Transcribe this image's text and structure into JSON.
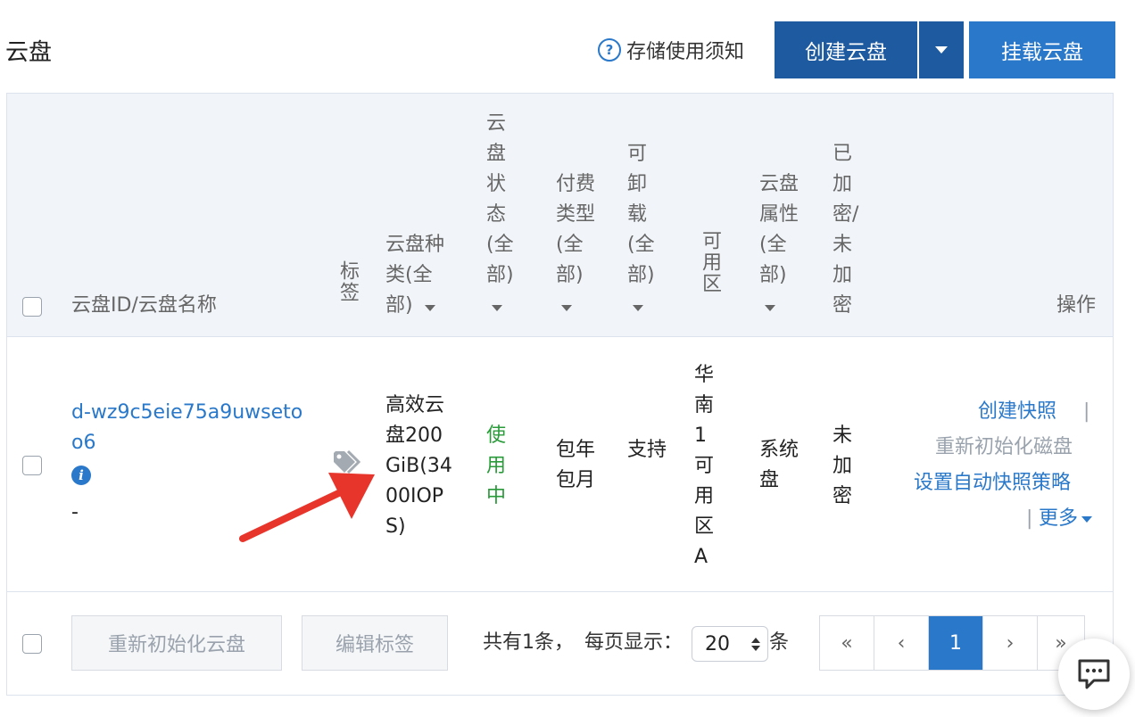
{
  "header": {
    "title": "云盘",
    "help_label": "存储使用须知",
    "create_label": "创建云盘",
    "mount_label": "挂载云盘"
  },
  "table": {
    "columns": {
      "id_name": "云盘ID/云盘名称",
      "tag": "标签",
      "category": "云盘种类(全部)",
      "status": "云盘状态(全部)",
      "billing": "付费类型(全部)",
      "detachable": "可卸载(全部)",
      "zone": "可用区",
      "attr": "云盘属性(全部)",
      "encrypted": "已加密/未加密",
      "actions": "操作"
    },
    "rows": [
      {
        "id": "d-wz9c5eie75a9uwsetoo6",
        "name": "-",
        "category": "高效云盘200GiB(3400IOPS)",
        "status": "使用中",
        "billing": "包年包月",
        "detachable": "支持",
        "zone": "华南1可用区A",
        "attr": "系统盘",
        "encrypted": "未加密",
        "actions": {
          "snapshot": "创建快照",
          "separator": "|",
          "reinit": "重新初始化磁盘",
          "auto_snapshot": "设置自动快照策略",
          "more": "更多"
        }
      }
    ]
  },
  "footer": {
    "reinit_label": "重新初始化云盘",
    "edit_tags_label": "编辑标签",
    "total_text": "共有1条，",
    "per_page_text": "每页显示：",
    "page_size": "20",
    "unit": "条",
    "pager": {
      "first": "«",
      "prev": "‹",
      "current": "1",
      "next": "›",
      "last": "»"
    }
  },
  "colors": {
    "primary": "#2a78c9",
    "primary_dark": "#1d5aa0",
    "status_green": "#2a9a3a",
    "annotation_arrow": "#e8352b"
  }
}
